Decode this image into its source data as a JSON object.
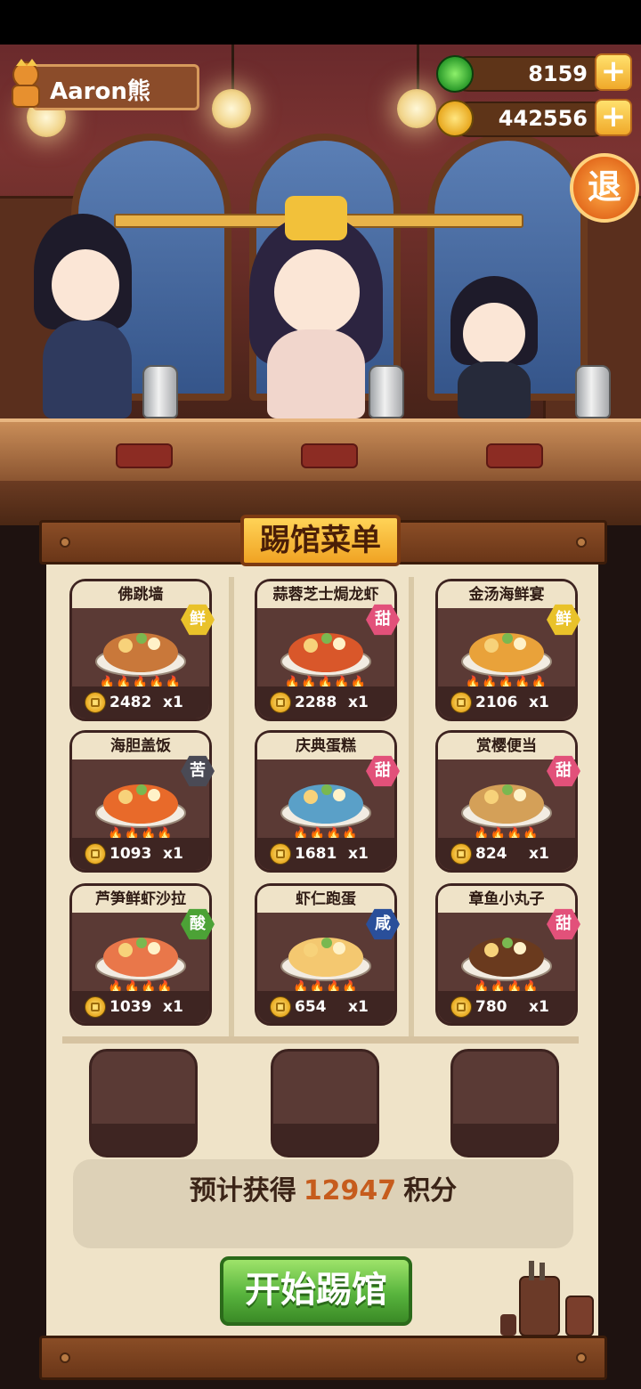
{
  "player": {
    "name": "Aaron熊"
  },
  "resources": {
    "jade": "8159",
    "coins": "442556",
    "plus_glyph": "+"
  },
  "exit_label": "退",
  "menu": {
    "title": "踢馆菜单",
    "dishes": [
      {
        "name": "佛跳墙",
        "tag": "鲜",
        "tag_color": "#e9c22a",
        "price": "2482",
        "qty": "x1",
        "flames": "🔥🔥🔥🔥🔥"
      },
      {
        "name": "蒜蓉芝士焗龙虾",
        "tag": "甜",
        "tag_color": "#e2517a",
        "price": "2288",
        "qty": "x1",
        "flames": "🔥🔥🔥🔥🔥"
      },
      {
        "name": "金汤海鲜宴",
        "tag": "鲜",
        "tag_color": "#e9c22a",
        "price": "2106",
        "qty": "x1",
        "flames": "🔥🔥🔥🔥🔥"
      },
      {
        "name": "海胆盖饭",
        "tag": "苦",
        "tag_color": "#4a4a55",
        "price": "1093",
        "qty": "x1",
        "flames": "🔥🔥🔥🔥"
      },
      {
        "name": "庆典蛋糕",
        "tag": "甜",
        "tag_color": "#e2517a",
        "price": "1681",
        "qty": "x1",
        "flames": "🔥🔥🔥🔥"
      },
      {
        "name": "赏樱便当",
        "tag": "甜",
        "tag_color": "#e2517a",
        "price": "824",
        "qty": "x1",
        "flames": "🔥🔥🔥🔥"
      },
      {
        "name": "芦笋鲜虾沙拉",
        "tag": "酸",
        "tag_color": "#4ca236",
        "price": "1039",
        "qty": "x1",
        "flames": "🔥🔥🔥🔥"
      },
      {
        "name": "虾仁跑蛋",
        "tag": "咸",
        "tag_color": "#2a4f9a",
        "price": "654",
        "qty": "x1",
        "flames": "🔥🔥🔥🔥"
      },
      {
        "name": "章鱼小丸子",
        "tag": "甜",
        "tag_color": "#e2517a",
        "price": "780",
        "qty": "x1",
        "flames": "🔥🔥🔥🔥"
      }
    ]
  },
  "estimate": {
    "prefix": "预计获得",
    "points": "12947",
    "suffix": "积分"
  },
  "start_button": "开始踢馆"
}
